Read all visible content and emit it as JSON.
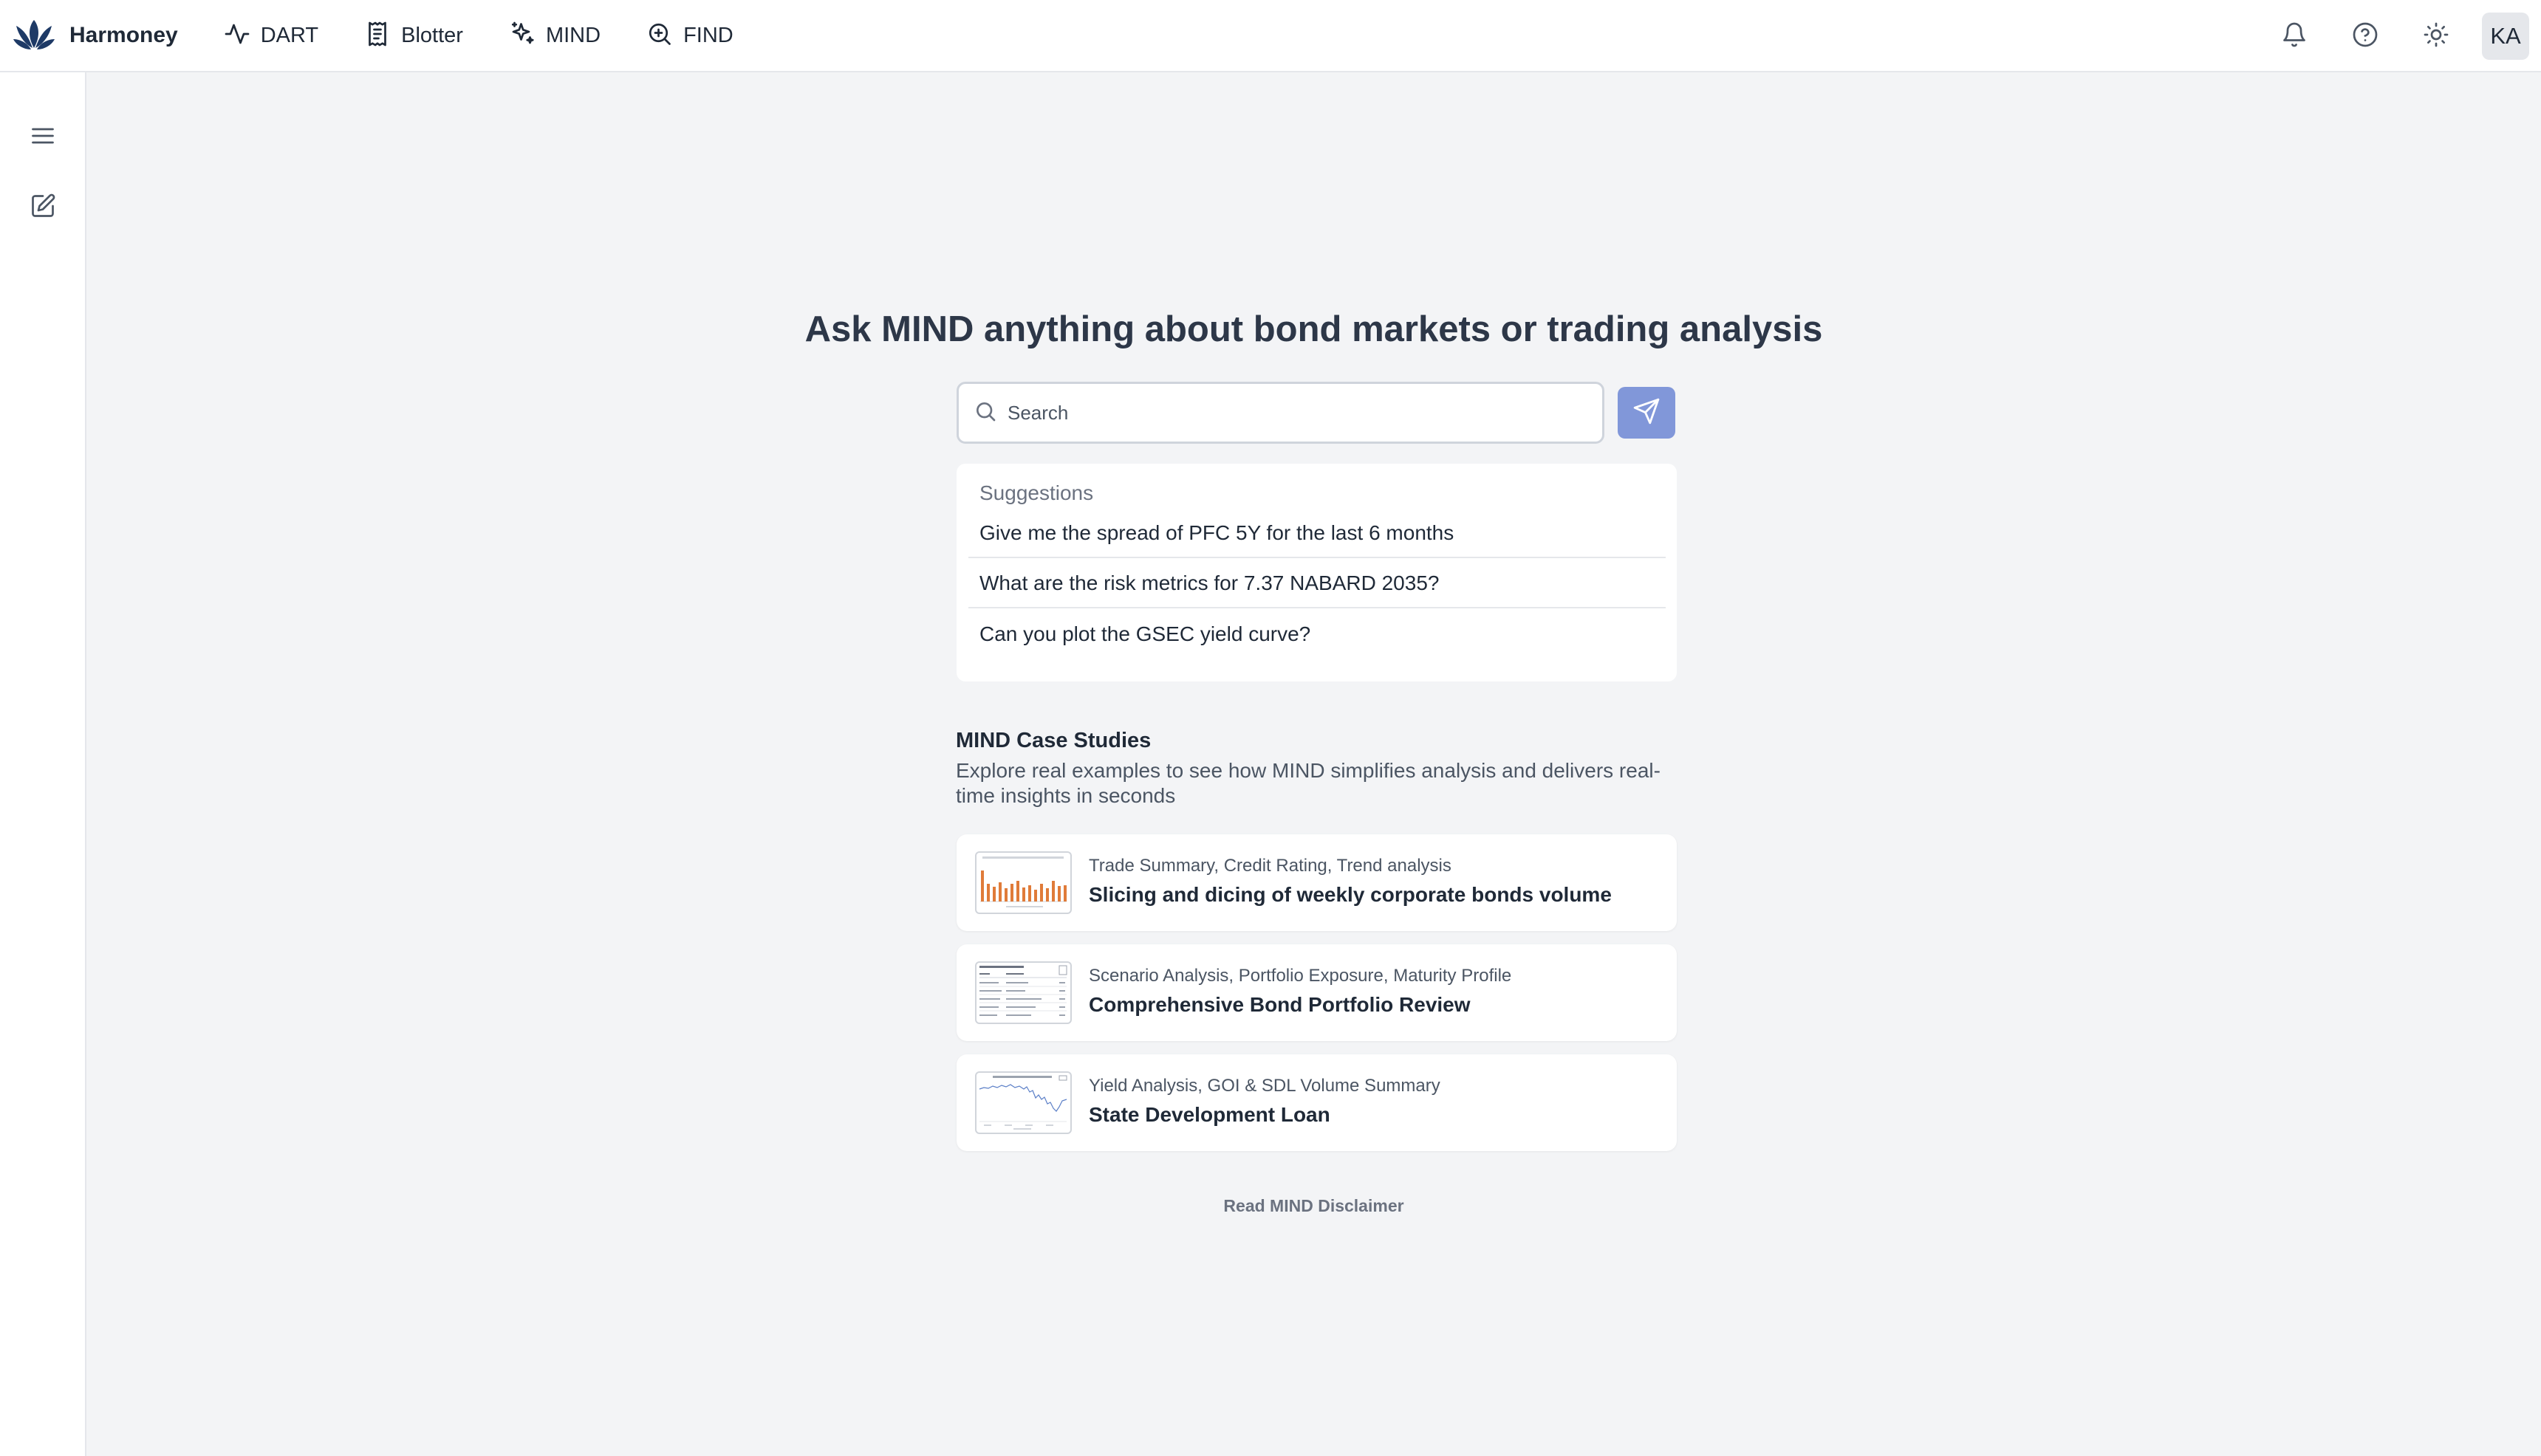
{
  "header": {
    "brand": "Harmoney",
    "nav": [
      {
        "label": "DART",
        "icon": "activity-icon"
      },
      {
        "label": "Blotter",
        "icon": "receipt-icon"
      },
      {
        "label": "MIND",
        "icon": "sparkles-icon"
      },
      {
        "label": "FIND",
        "icon": "zoom-in-icon"
      }
    ],
    "right_icons": [
      "bell-icon",
      "help-circle-icon",
      "sun-icon"
    ],
    "avatar_initials": "KA"
  },
  "sidebar": {
    "icons": [
      "menu-icon",
      "edit-icon"
    ]
  },
  "main": {
    "headline": "Ask MIND anything about bond markets or trading analysis",
    "search": {
      "placeholder": "Search",
      "value": ""
    },
    "send_icon": "send-icon",
    "suggestions": {
      "title": "Suggestions",
      "items": [
        "Give me the spread of PFC 5Y for the last 6 months",
        "What are the risk metrics for 7.37 NABARD 2035?",
        "Can you plot the GSEC yield curve?"
      ]
    },
    "case_studies": {
      "title": "MIND Case Studies",
      "subtitle": "Explore real examples to see how MIND simplifies analysis and delivers real-time insights in seconds",
      "items": [
        {
          "tags": "Trade Summary, Credit Rating, Trend analysis",
          "title": "Slicing and dicing of weekly corporate bonds volume",
          "thumbnail": "bar-chart-thumbnail"
        },
        {
          "tags": "Scenario Analysis, Portfolio Exposure, Maturity Profile",
          "title": "Comprehensive Bond Portfolio Review",
          "thumbnail": "table-thumbnail"
        },
        {
          "tags": "Yield Analysis, GOI & SDL Volume Summary",
          "title": "State Development Loan",
          "thumbnail": "line-chart-thumbnail"
        }
      ]
    },
    "disclaimer": "Read MIND Disclaimer"
  },
  "colors": {
    "background": "#f3f4f6",
    "surface": "#ffffff",
    "accent": "#8197d9",
    "brand": "#1e3a66",
    "text": "#1f2937",
    "muted": "#6b7280"
  }
}
